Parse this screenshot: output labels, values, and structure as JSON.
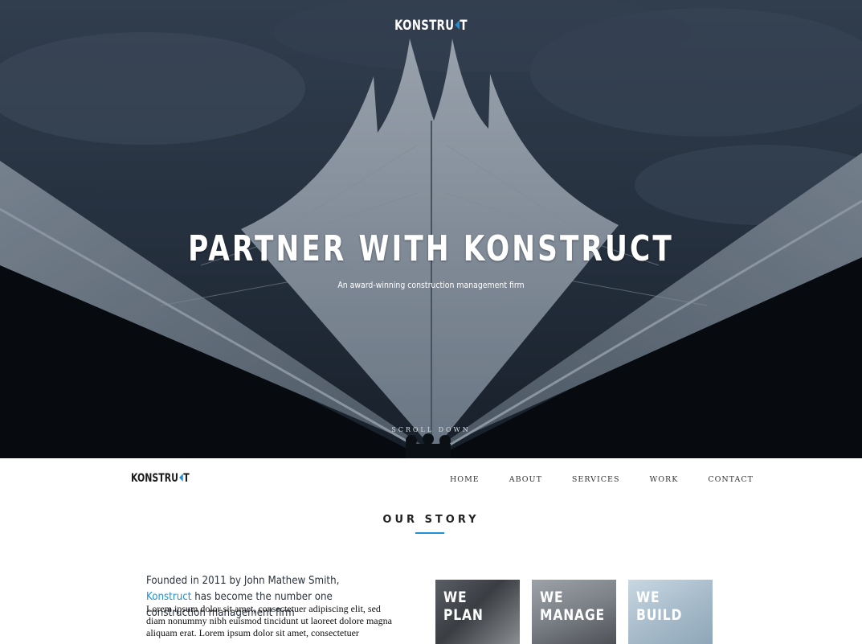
{
  "hero": {
    "logo": {
      "prefix": "KONSTRU",
      "suffix": "T"
    },
    "title": "PARTNER WITH KONSTRUCT",
    "subtitle": "An award-winning construction management firm",
    "scroll_label": "SCROLL DOWN"
  },
  "nav": {
    "logo": {
      "prefix": "KONSTRU",
      "suffix": "T"
    },
    "items": [
      {
        "label": "HOME"
      },
      {
        "label": "ABOUT"
      },
      {
        "label": "SERVICES"
      },
      {
        "label": "WORK"
      },
      {
        "label": "CONTACT"
      }
    ]
  },
  "story": {
    "section_title": "OUR STORY",
    "heading_pre": "Founded in 2011 by John Mathew Smith,",
    "heading_brand": "Konstruct",
    "heading_post": "has become the number one construction management firm",
    "body": "Lorem ipsum dolor sit amet, consectetuer adipiscing elit, sed diam nonummy nibh euismod tincidunt ut laoreet dolore magna aliquam erat. Lorem ipsum dolor sit amet, consectetuer",
    "tiles": [
      {
        "line1": "WE",
        "line2": "PLAN"
      },
      {
        "line1": "WE",
        "line2": "MANAGE"
      },
      {
        "line1": "WE",
        "line2": "BUILD"
      }
    ]
  },
  "colors": {
    "accent": "#1e90d6",
    "hero_sky": "#2a3443",
    "text_dark": "#222222"
  }
}
